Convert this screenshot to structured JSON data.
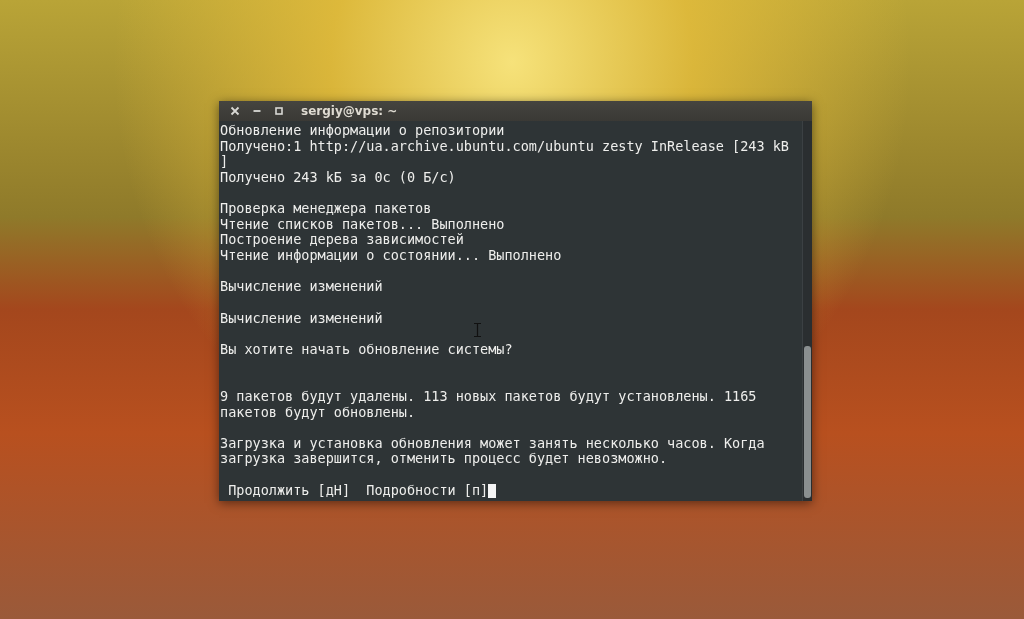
{
  "window": {
    "title": "sergiy@vps: ~",
    "buttons": [
      {
        "kind": "close"
      },
      {
        "kind": "minimize"
      },
      {
        "kind": "maximize"
      }
    ]
  },
  "terminal": {
    "lines": [
      {
        "kind": "text",
        "text": "Обновление информации о репозитории"
      },
      {
        "kind": "text",
        "text": "Получено:1 http://ua.archive.ubuntu.com/ubuntu zesty InRelease [243 kB"
      },
      {
        "kind": "text",
        "text": "]"
      },
      {
        "kind": "text",
        "text": "Получено 243 kБ за 0с (0 Б/с)"
      },
      {
        "kind": "blank"
      },
      {
        "kind": "text",
        "text": "Проверка менеджера пакетов"
      },
      {
        "kind": "text",
        "text": "Чтение списков пакетов... Выполнено"
      },
      {
        "kind": "text",
        "text": "Построение дерева зависимостей"
      },
      {
        "kind": "text",
        "text": "Чтение информации о состоянии... Выполнено"
      },
      {
        "kind": "blank"
      },
      {
        "kind": "text",
        "text": "Вычисление изменений"
      },
      {
        "kind": "blank"
      },
      {
        "kind": "text",
        "text": "Вычисление изменений"
      },
      {
        "kind": "blank"
      },
      {
        "kind": "text",
        "text": "Вы хотите начать обновление системы?"
      },
      {
        "kind": "blank"
      },
      {
        "kind": "blank"
      },
      {
        "kind": "text",
        "text": "9 пакетов будут удалены. 113 новых пакетов будут установлены. 1165"
      },
      {
        "kind": "text",
        "text": "пакетов будут обновлены."
      },
      {
        "kind": "blank"
      },
      {
        "kind": "text",
        "text": "Загрузка и установка обновления может занять несколько часов. Когда"
      },
      {
        "kind": "text",
        "text": "загрузка завершится, отменить процесс будет невозможно."
      },
      {
        "kind": "blank"
      },
      {
        "kind": "prompt",
        "text": " Продолжить [дН]  Подробности [п]"
      }
    ]
  }
}
